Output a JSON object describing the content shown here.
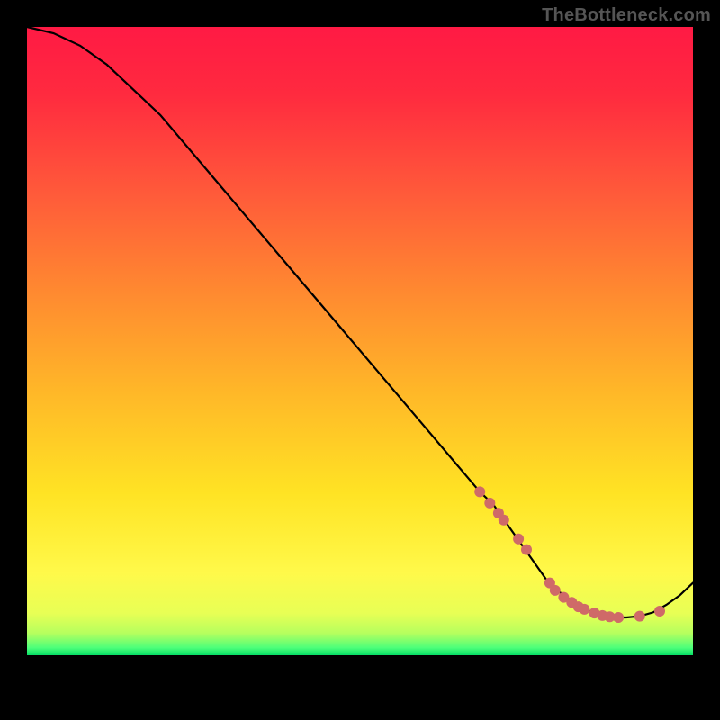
{
  "watermark": "TheBottleneck.com",
  "chart_data": {
    "type": "line",
    "title": "",
    "xlabel": "",
    "ylabel": "",
    "xlim": [
      0,
      100
    ],
    "ylim": [
      0,
      100
    ],
    "series": [
      {
        "name": "bottleneck-curve",
        "x": [
          0,
          4,
          8,
          12,
          16,
          20,
          24,
          28,
          32,
          36,
          40,
          44,
          48,
          52,
          56,
          60,
          64,
          68,
          70,
          72,
          74,
          76,
          78,
          80,
          82,
          84,
          86,
          88,
          90,
          92,
          94,
          96,
          98,
          100
        ],
        "values": [
          100,
          99,
          97,
          94,
          90,
          86,
          81,
          76,
          71,
          66,
          61,
          56,
          51,
          46,
          41,
          36,
          31,
          26,
          24,
          21,
          18,
          15,
          12,
          10,
          8.5,
          7.2,
          6.4,
          6.0,
          6.0,
          6.2,
          6.8,
          8.0,
          9.5,
          11.5
        ]
      }
    ],
    "markers": [
      {
        "name": "highlight-point",
        "x": 68.0,
        "y": 26.0
      },
      {
        "name": "highlight-point",
        "x": 69.5,
        "y": 24.2
      },
      {
        "name": "highlight-point",
        "x": 70.8,
        "y": 22.6
      },
      {
        "name": "highlight-point",
        "x": 71.6,
        "y": 21.5
      },
      {
        "name": "highlight-point",
        "x": 73.8,
        "y": 18.5
      },
      {
        "name": "highlight-point",
        "x": 75.0,
        "y": 16.8
      },
      {
        "name": "highlight-point",
        "x": 78.5,
        "y": 11.5
      },
      {
        "name": "highlight-point",
        "x": 79.3,
        "y": 10.3
      },
      {
        "name": "highlight-point",
        "x": 80.6,
        "y": 9.2
      },
      {
        "name": "highlight-point",
        "x": 81.8,
        "y": 8.4
      },
      {
        "name": "highlight-point",
        "x": 82.8,
        "y": 7.7
      },
      {
        "name": "highlight-point",
        "x": 83.7,
        "y": 7.3
      },
      {
        "name": "highlight-point",
        "x": 85.2,
        "y": 6.7
      },
      {
        "name": "highlight-point",
        "x": 86.4,
        "y": 6.3
      },
      {
        "name": "highlight-point",
        "x": 87.5,
        "y": 6.1
      },
      {
        "name": "highlight-point",
        "x": 88.8,
        "y": 6.0
      },
      {
        "name": "highlight-point",
        "x": 92.0,
        "y": 6.2
      },
      {
        "name": "highlight-point",
        "x": 95.0,
        "y": 7.0
      }
    ],
    "colors": {
      "curve": "#000000",
      "marker": "#cf6a68",
      "gradient_top": "#ff1a44",
      "gradient_mid": "#ffe324",
      "gradient_green": "#08e066"
    }
  }
}
